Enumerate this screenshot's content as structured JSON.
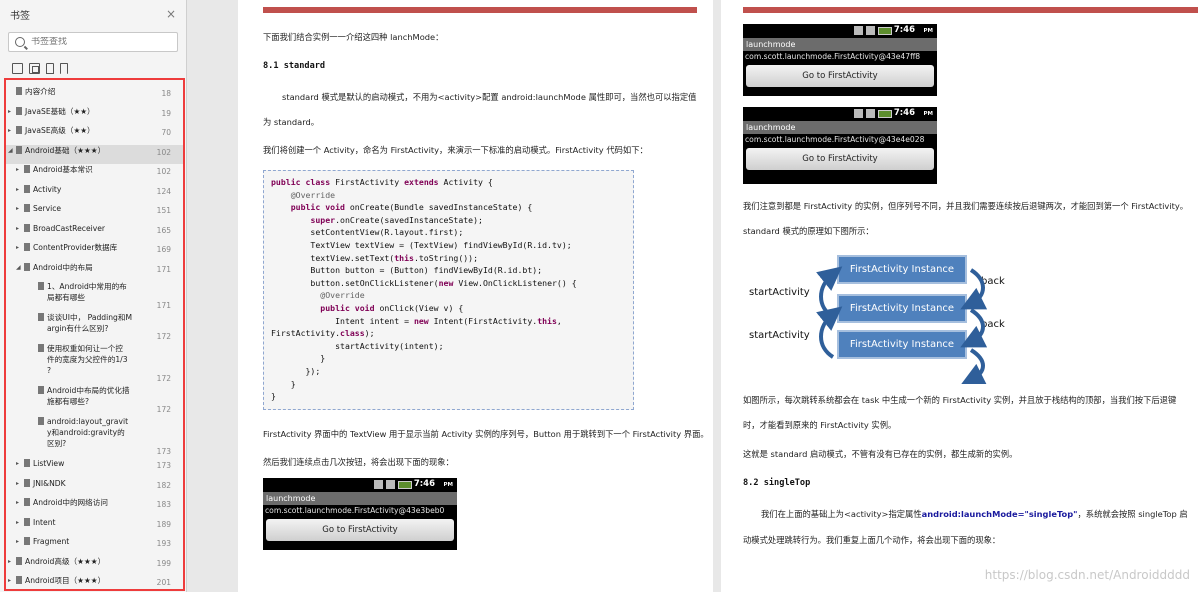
{
  "sidebar": {
    "title": "书签",
    "close_label": "×",
    "search_placeholder": "书签查找",
    "toc": [
      {
        "label": "内容介绍",
        "page": "18",
        "level": 0,
        "arrow": ""
      },
      {
        "label": "JavaSE基础（★★）",
        "page": "19",
        "level": 0,
        "arrow": "▸"
      },
      {
        "label": "JavaSE高级（★★）",
        "page": "70",
        "level": 0,
        "arrow": "▸"
      },
      {
        "label": "Android基础（★★★）",
        "page": "102",
        "level": 0,
        "arrow": "◢",
        "selected": true
      },
      {
        "label": "Android基本常识",
        "page": "102",
        "level": 1,
        "arrow": "▸"
      },
      {
        "label": "Activity",
        "page": "124",
        "level": 1,
        "arrow": "▸"
      },
      {
        "label": "Service",
        "page": "151",
        "level": 1,
        "arrow": "▸"
      },
      {
        "label": "BroadCastReceiver",
        "page": "165",
        "level": 1,
        "arrow": "▸"
      },
      {
        "label": "ContentProvider数据库",
        "page": "169",
        "level": 1,
        "arrow": "▸"
      },
      {
        "label": "Android中的布局",
        "page": "171",
        "level": 1,
        "arrow": "◢"
      },
      {
        "label": "1、Android中常用的布\n局都有哪些",
        "page": "171",
        "level": 2,
        "arrow": ""
      },
      {
        "label": "谈谈UI中， Padding和M\nargin有什么区别?",
        "page": "172",
        "level": 2,
        "arrow": ""
      },
      {
        "label": "使用权重如何让一个控\n件的宽度为父控件的1/3\n?",
        "page": "172",
        "level": 2,
        "arrow": ""
      },
      {
        "label": "Android中布局的优化措\n施都有哪些?",
        "page": "172",
        "level": 2,
        "arrow": ""
      },
      {
        "label": "android:layout_gravit\ny和android:gravity的\n区别?",
        "page": "173",
        "level": 2,
        "arrow": ""
      },
      {
        "label": "ListView",
        "page": "173",
        "level": 1,
        "arrow": "▸"
      },
      {
        "label": "JNI&NDK",
        "page": "182",
        "level": 1,
        "arrow": "▸"
      },
      {
        "label": "Android中的网络访问",
        "page": "183",
        "level": 1,
        "arrow": "▸"
      },
      {
        "label": "Intent",
        "page": "189",
        "level": 1,
        "arrow": "▸"
      },
      {
        "label": "Fragment",
        "page": "193",
        "level": 1,
        "arrow": "▸"
      },
      {
        "label": "Android高级（★★★）",
        "page": "199",
        "level": 0,
        "arrow": "▸"
      },
      {
        "label": "Android项目（★★★）",
        "page": "201",
        "level": 0,
        "arrow": "▸"
      }
    ]
  },
  "left_page": {
    "intro": "下面我们结合实例一一介绍这四种 lanchMode：",
    "section": "8.1 standard",
    "para1": "standard 模式是默认的启动模式，不用为<activity>配置 android:launchMode 属性即可，当然也可以指定值",
    "para1b": "为 standard。",
    "para2": "我们将创建一个 Activity，命名为 FirstActivity，来演示一下标准的启动模式。FirstActivity 代码如下：",
    "para3": "FirstActivity 界面中的 TextView 用于显示当前 Activity 实例的序列号，Button 用于跳转到下一个 FirstActivity 界面。",
    "para4": "然后我们连续点击几次按钮，将会出现下面的现象：",
    "phone": {
      "time": "7:46",
      "pm": "PM",
      "title": "launchmode",
      "value": "com.scott.launchmode.FirstActivity@43e3beb0",
      "button": "Go to FirstActivity"
    }
  },
  "right_page": {
    "phones": [
      {
        "time": "7:46",
        "pm": "PM",
        "title": "launchmode",
        "value": "com.scott.launchmode.FirstActivity@43e47ff8",
        "button": "Go to FirstActivity"
      },
      {
        "time": "7:46",
        "pm": "PM",
        "title": "launchmode",
        "value": "com.scott.launchmode.FirstActivity@43e4e028",
        "button": "Go to FirstActivity"
      }
    ],
    "para1": "我们注意到都是 FirstActivity 的实例，但序列号不同，并且我们需要连续按后退键两次，才能回到第一个 FirstActivity。",
    "para1b": "standard 模式的原理如下图所示：",
    "diagram": {
      "boxes": [
        "FirstActivity Instance",
        "FirstActivity Instance",
        "FirstActivity Instance"
      ],
      "start_labels": [
        "startActivity",
        "startActivity"
      ],
      "back_labels": [
        "back",
        "back"
      ]
    },
    "para2": "如图所示，每次跳转系统都会在 task 中生成一个新的 FirstActivity 实例，并且放于栈结构的顶部，当我们按下后退键",
    "para2b": "时，才能看到原来的 FirstActivity 实例。",
    "para3": "这就是 standard 启动模式，不管有没有已存在的实例，都生成新的实例。",
    "section": "8.2 singleTop",
    "para4a": "我们在上面的基础上为<activity>指定属性",
    "para4_code": "android:launchMode=\"singleTop\"",
    "para4b": "，系统就会按照 singleTop 启",
    "para4c": "动模式处理跳转行为。我们重复上面几个动作，将会出现下面的现象：",
    "watermark": "https://blog.csdn.net/Androiddddd"
  },
  "colors": {
    "accent_bar": "#c0504d",
    "highlight_border": "#ee3c3c",
    "box_blue": "#4f81bd",
    "keyword": "#7f0055"
  }
}
